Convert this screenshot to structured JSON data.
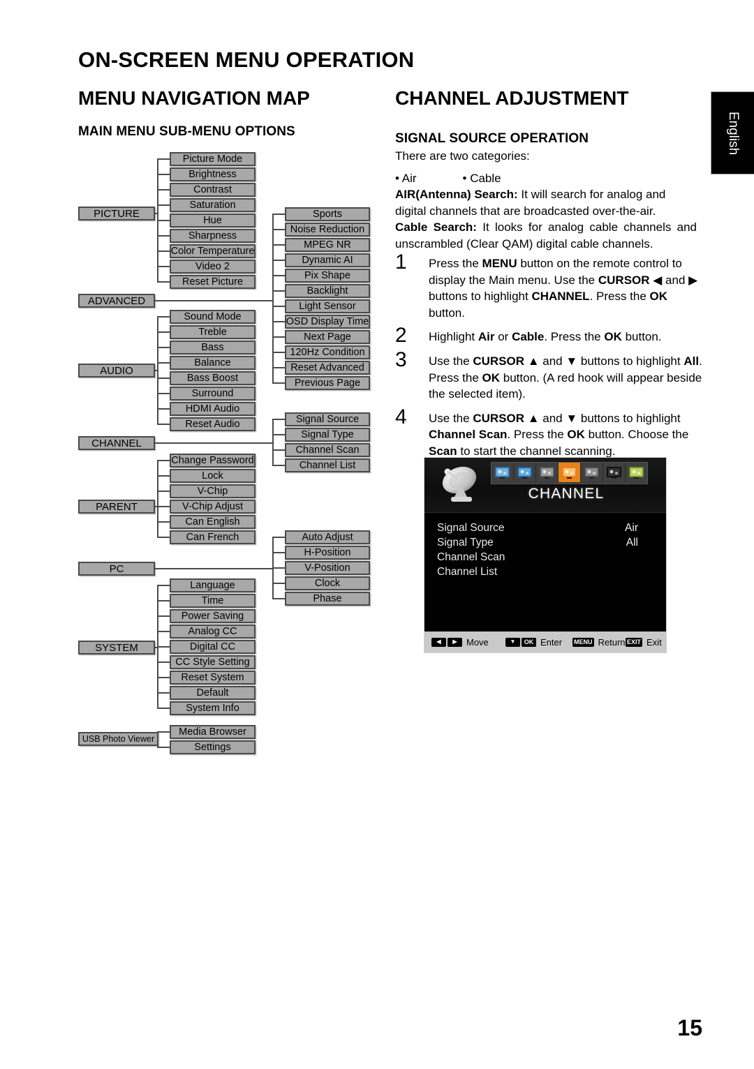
{
  "page": {
    "title": "ON-SCREEN MENU OPERATION",
    "number": "15",
    "language_tab": "English"
  },
  "left_column": {
    "section_title": "MENU NAVIGATION MAP",
    "sub_title": "MAIN MENU SUB-MENU OPTIONS",
    "groups": [
      {
        "main": "PICTURE",
        "items": [
          "Picture Mode",
          "Brightness",
          "Contrast",
          "Saturation",
          "Hue",
          "Sharpness",
          "Color Temperature",
          "Video 2",
          "Reset Picture"
        ]
      },
      {
        "main": "ADVANCED",
        "items": [
          "Sports",
          "Noise Reduction",
          "MPEG NR",
          "Dynamic AI",
          "Pix Shape",
          "Backlight",
          "Light Sensor",
          "OSD Display Time",
          "Next Page",
          "120Hz Condition",
          "Reset Advanced",
          "Previous Page"
        ]
      },
      {
        "main": "AUDIO",
        "items": [
          "Sound Mode",
          "Treble",
          "Bass",
          "Balance",
          "Bass Boost",
          "Surround",
          "HDMI Audio",
          "Reset Audio"
        ]
      },
      {
        "main": "CHANNEL",
        "items": [
          "Signal Source",
          "Signal Type",
          "Channel Scan",
          "Channel List"
        ]
      },
      {
        "main": "PARENT",
        "items": [
          "Change Password",
          "Lock",
          "V-Chip",
          "V-Chip Adjust",
          "Can English",
          "Can French"
        ]
      },
      {
        "main": "PC",
        "items": [
          "Auto Adjust",
          "H-Position",
          "V-Position",
          "Clock",
          "Phase"
        ]
      },
      {
        "main": "SYSTEM",
        "items": [
          "Language",
          "Time",
          "Power Saving",
          "Analog CC",
          "Digital CC",
          "CC Style Setting",
          "Reset System",
          "Default",
          "System Info"
        ]
      },
      {
        "main": "USB Photo Viewer",
        "items": [
          "Media Browser",
          "Settings"
        ]
      }
    ]
  },
  "right_column": {
    "section_title": "CHANNEL ADJUSTMENT",
    "sub_title": "SIGNAL SOURCE OPERATION",
    "intro": "There are two categories:",
    "bullet_1": "• Air",
    "bullet_2": "• Cable",
    "air_label": "AIR(Antenna) Search:",
    "air_text": " It will search for analog and digital channels that are broadcasted over-the-air.",
    "cable_label": "Cable Search:",
    "cable_text": " It looks for analog cable channels and unscrambled (Clear QAM) digital cable channels.",
    "steps": [
      {
        "num": "1",
        "html": "Press the <b>MENU</b> button on the remote control to display the Main menu. Use the <b>CURSOR</b> &#9664; and &#9654; buttons to highlight <b>CHANNEL</b>. Press the <b>OK</b> button."
      },
      {
        "num": "2",
        "html": "Highlight <b>Air</b> or <b>Cable</b>. Press the <b>OK</b> button."
      },
      {
        "num": "3",
        "html": "Use the <b>CURSOR</b> &#9650; and &#9660; buttons to highlight <b>All</b>. Press the <b>OK</b> button. (A red hook will appear beside the selected item)."
      },
      {
        "num": "4",
        "html": "Use the <b>CURSOR</b> &#9650; and &#9660; buttons to highlight <b>Channel Scan</b>. Press the <b>OK</b> button. Choose the <b>Scan</b> to start the channel scanning."
      }
    ]
  },
  "osd": {
    "title": "CHANNEL",
    "tab_icons": [
      "picture-icon",
      "advanced-icon",
      "audio-icon",
      "channel-icon",
      "parent-icon",
      "pc-icon",
      "system-icon"
    ],
    "active_tab_index": 3,
    "accent_color": "#e8821a",
    "rows": [
      {
        "label": "Signal Source",
        "value": "Air"
      },
      {
        "label": "Signal Type",
        "value": "All"
      },
      {
        "label": "Channel Scan",
        "value": ""
      },
      {
        "label": "Channel List",
        "value": ""
      }
    ],
    "footer": [
      {
        "keys": [
          "◀",
          "▶"
        ],
        "label": "Move"
      },
      {
        "keys": [
          "▼",
          "OK"
        ],
        "label": "Enter"
      },
      {
        "keys": [
          "MENU"
        ],
        "label": "Return"
      },
      {
        "keys": [
          "EXIT"
        ],
        "label": "Exit"
      }
    ]
  }
}
